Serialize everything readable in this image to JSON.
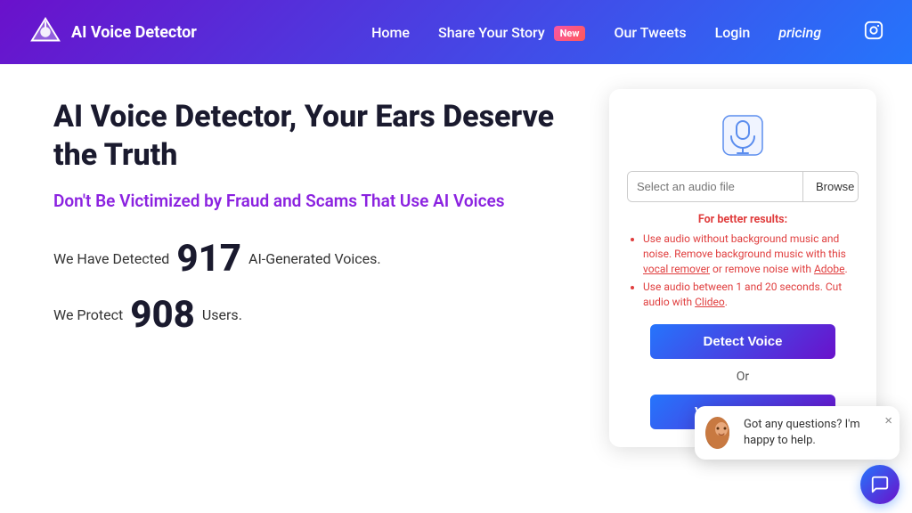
{
  "nav": {
    "brand_label": "AI Voice Detector",
    "links": [
      {
        "label": "Home",
        "name": "home"
      },
      {
        "label": "Share Your Story",
        "name": "share-story",
        "badge": "New"
      },
      {
        "label": "Our Tweets",
        "name": "our-tweets"
      },
      {
        "label": "Login",
        "name": "login"
      },
      {
        "label": "pricing",
        "name": "pricing"
      }
    ]
  },
  "hero": {
    "title": "AI Voice Detector, Your Ears Deserve the Truth",
    "subtitle": "Don't Be Victimized by Fraud and Scams That Use AI Voices",
    "detected_label": "We Have Detected",
    "detected_count": "917",
    "detected_suffix": "AI-Generated Voices.",
    "protect_label": "We Protect",
    "protect_count": "908",
    "protect_suffix": "Users."
  },
  "card": {
    "file_placeholder": "Select an audio file",
    "browse_label": "Browse",
    "tips_title": "For better results:",
    "tips": [
      "Use audio without background music and noise. Remove background music with this vocal remover or remove noise with Adobe.",
      "Use audio between 1 and 20 seconds. Cut audio with Clideo."
    ],
    "detect_label": "Detect Voice",
    "or_label": "Or",
    "examples_label": "View Examples"
  },
  "chat": {
    "message": "Got any questions? I'm happy to help.",
    "close_label": "×"
  },
  "icons": {
    "mic": "🎙",
    "instagram": "📷",
    "chat_bubble": "💬"
  }
}
